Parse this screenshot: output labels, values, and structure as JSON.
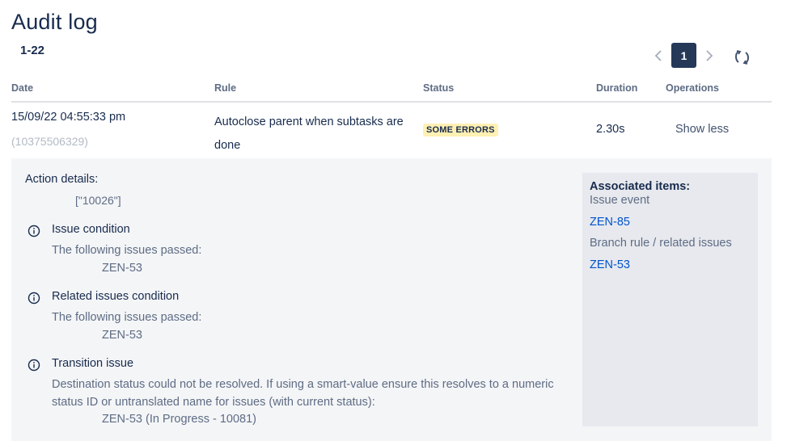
{
  "page": {
    "title": "Audit log",
    "range": "1-22"
  },
  "pagination": {
    "current": "1",
    "prev_icon": "chevron-left-icon",
    "next_icon": "chevron-right-icon",
    "refresh_icon": "refresh-icon"
  },
  "table": {
    "headers": {
      "date": "Date",
      "rule": "Rule",
      "status": "Status",
      "duration": "Duration",
      "operations": "Operations"
    },
    "row": {
      "date": "15/09/22 04:55:33 pm",
      "id": "(10375506329)",
      "rule": "Autoclose parent when subtasks are done",
      "status": "SOME ERRORS",
      "duration": "2.30s",
      "operation": "Show less"
    }
  },
  "details": {
    "action_heading": "Action details:",
    "action_value": "[\"10026\"]",
    "conditions": [
      {
        "title": "Issue condition",
        "description": "The following issues passed:",
        "value": "ZEN-53"
      },
      {
        "title": "Related issues condition",
        "description": "The following issues passed:",
        "value": "ZEN-53"
      },
      {
        "title": "Transition issue",
        "description": "Destination status could not be resolved. If using a smart-value ensure this resolves to a numeric status ID or untranslated name for issues (with current status):",
        "value": "ZEN-53 (In Progress - 10081)"
      }
    ],
    "associated": {
      "heading": "Associated items:",
      "issue_event_label": "Issue event",
      "issue_event_link": "ZEN-85",
      "branch_label": "Branch rule / related issues",
      "branch_link": "ZEN-53"
    }
  },
  "colors": {
    "badge_bg": "#fff0b3",
    "pager_active": "#253858",
    "link": "#0052cc"
  }
}
